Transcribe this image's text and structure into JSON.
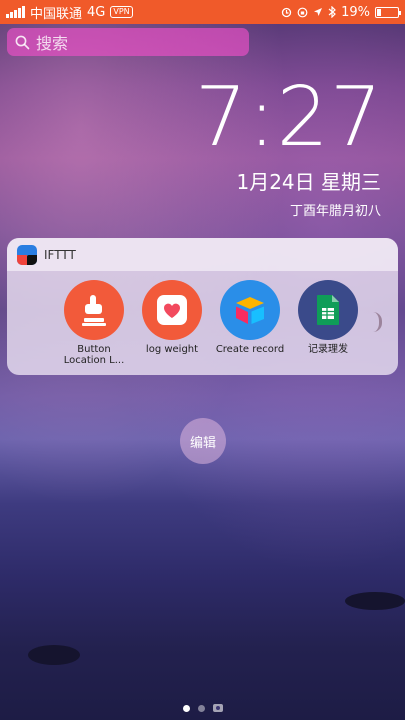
{
  "status_bar": {
    "carrier": "中国联通",
    "network": "4G",
    "vpn": "VPN",
    "battery_percent": "19%",
    "battery_level": 0.19,
    "background_color": "#f05a2a"
  },
  "search": {
    "placeholder": "搜索",
    "icon": "search-icon"
  },
  "clock": {
    "time": "7:27",
    "date": "1月24日 星期三",
    "lunar_date": "丁酉年腊月初八"
  },
  "widget": {
    "title": "IFTTT",
    "applets": [
      {
        "label": "Button Location L...",
        "icon": "hand-tap-icon",
        "color": "#f25a3a"
      },
      {
        "label": "log weight",
        "icon": "health-heart-icon",
        "color": "#f25a3a"
      },
      {
        "label": "Create record",
        "icon": "airtable-icon",
        "color": "#2a8ee8"
      },
      {
        "label": "记录理发",
        "icon": "google-sheets-icon",
        "color": "#3a4a8a"
      }
    ]
  },
  "edit_button": {
    "label": "编辑"
  },
  "page_indicator": {
    "pages": 2,
    "current": 1
  }
}
